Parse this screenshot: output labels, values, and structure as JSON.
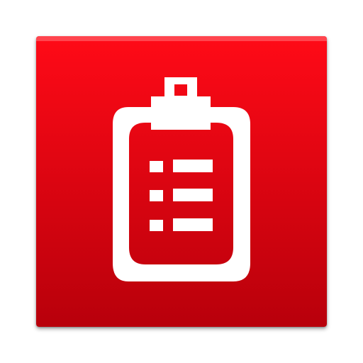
{
  "icon": {
    "name": "clipboard-checklist-icon",
    "colors": {
      "tile_top": "#ff0a17",
      "tile_bottom": "#b8000b",
      "highlight": "#ff5a62",
      "glyph": "#ffffff"
    },
    "checklist_rows": 3
  }
}
